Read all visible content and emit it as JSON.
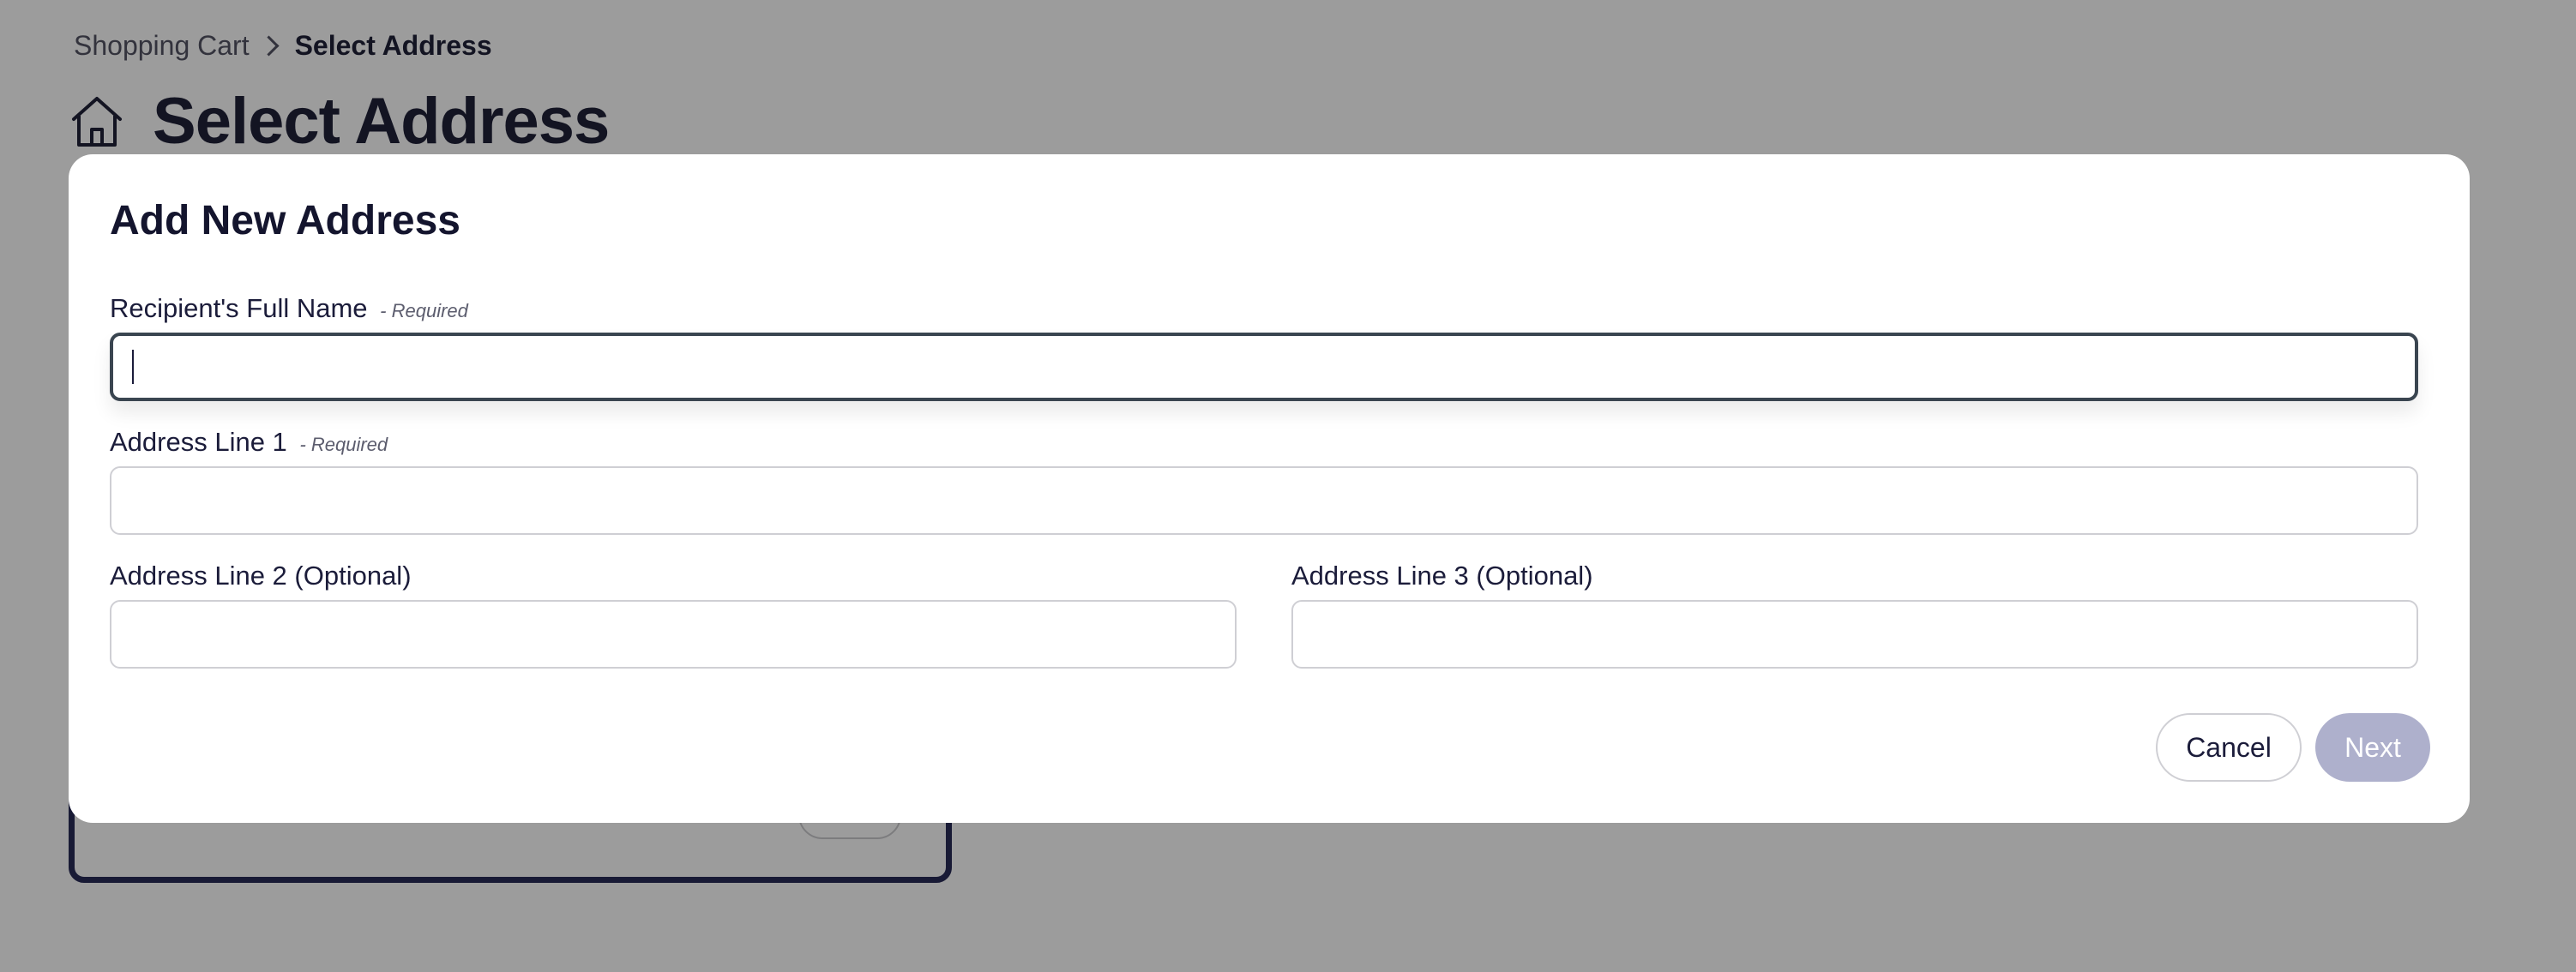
{
  "breadcrumb": {
    "parent": "Shopping Cart",
    "current": "Select Address"
  },
  "page": {
    "title": "Select Address",
    "icon": "home-icon"
  },
  "modal": {
    "title": "Add New Address",
    "required_suffix": "- Required",
    "fields": {
      "full_name": {
        "label": "Recipient's Full Name",
        "value": "",
        "focused": true
      },
      "address_line_1": {
        "label": "Address Line 1",
        "value": ""
      },
      "address_line_2": {
        "label": "Address Line 2 (Optional)",
        "value": ""
      },
      "address_line_3": {
        "label": "Address Line 3 (Optional)",
        "value": ""
      }
    },
    "buttons": {
      "cancel": "Cancel",
      "next": "Next",
      "next_disabled": true
    }
  },
  "colors": {
    "brand_dark": "#14152e",
    "card_border": "#1d1f4f",
    "next_disabled": "#aeb0cc",
    "focus_border": "#3a4550"
  }
}
